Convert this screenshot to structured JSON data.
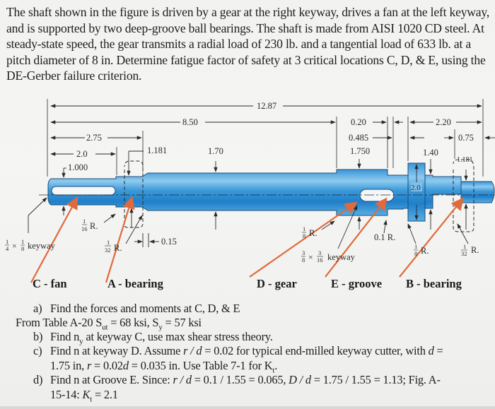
{
  "problem": {
    "intro": "The shaft shown in the figure is driven by a gear at the right keyway, drives a fan at the left keyway, and is supported by two deep-groove ball bearings. The shaft is made from AISI 1020 CD steel. At steady-state speed, the gear transmits a radial load of 230 lb. and a tangential load of 633 lb. at a pitch diameter of 8 in. Determine fatigue factor of safety at 3 critical locations C, D, & E, using the DE-Gerber failure criterion."
  },
  "figure": {
    "dimensions": {
      "overall": "12.87",
      "to_gear_shoulder": "8.50",
      "d275": "2.75",
      "d20": "2.0",
      "dia_1000": "1.000",
      "dia_1181_left": "1.181",
      "dia_170": "1.70",
      "d020": "0.20",
      "d0485": "0.485",
      "dia_1750": "1.750",
      "d220": "2.20",
      "d075": "0.75",
      "dia_140": "1.40",
      "dia_1181_right": "1.181",
      "collar_dia": "2.0",
      "d015": "0.15",
      "fillet_01": "0.1 R."
    },
    "fillets": {
      "r16": {
        "num": "1",
        "den": "16",
        "suffix": "R."
      },
      "r32_left": {
        "num": "1",
        "den": "32",
        "suffix": "R."
      },
      "r8_left": {
        "num": "1",
        "den": "8",
        "suffix": "R."
      },
      "r8_right": {
        "num": "1",
        "den": "8",
        "suffix": "R."
      },
      "r32_right": {
        "num": "1",
        "den": "32",
        "suffix": "R."
      }
    },
    "keyways": {
      "left": {
        "a_num": "1",
        "a_den": "4",
        "b_num": "1",
        "b_den": "8",
        "suffix": "keyway"
      },
      "right": {
        "a_num": "3",
        "a_den": "8",
        "b_num": "3",
        "b_den": "16",
        "suffix": "keyway"
      }
    },
    "locations": [
      {
        "label": "C - fan"
      },
      {
        "label": "A - bearing"
      },
      {
        "label": "D - gear"
      },
      {
        "label": "E - groove"
      },
      {
        "label": "B - bearing"
      }
    ],
    "colors": {
      "shaft": "#2f8fd3",
      "shaft_light": "#8cc9ee",
      "arrow": "#e06a3c",
      "line": "#2a2a2a"
    }
  },
  "questions": {
    "a": {
      "tag": "a)",
      "text": "Find the forces and moments at C, D, & E"
    },
    "table": {
      "pre": "From Table A-20 S",
      "sut_sub": "ut",
      "mid": " = 68 ksi, S",
      "sy_sub": "y",
      "post": " = 57 ksi"
    },
    "b": {
      "tag": "b)",
      "pre": "Find n",
      "sub": "y",
      "post": " at keyway C, use max shear stress theory."
    },
    "c": {
      "tag": "c)",
      "line1_pre": "Find n at keyway D. Assume ",
      "rd": "r / d",
      "line1_post": " = 0.02 for typical end-milled keyway cutter, with ",
      "d": "d",
      "eq": " =",
      "line2_pre": "1.75 in, ",
      "r": "r",
      "line2_mid": " = 0.02",
      "d2": "d",
      "line2_post": " = 0.035 in. Use Table 7-1 for K",
      "kt_sub": "t",
      "end": "."
    },
    "d": {
      "tag": "d)",
      "line1_pre": "Find n at Groove E. Since: ",
      "rd": "r / d",
      "line1_mid": " = 0.1 / 1.55 = 0.065, ",
      "Dd": "D / d",
      "line1_post": " = 1.75 / 1.55 = 1.13; Fig. A-",
      "line2_pre": "15-14: ",
      "K": "K",
      "K_sub": "t",
      "line2_post": " = 2.1"
    }
  }
}
